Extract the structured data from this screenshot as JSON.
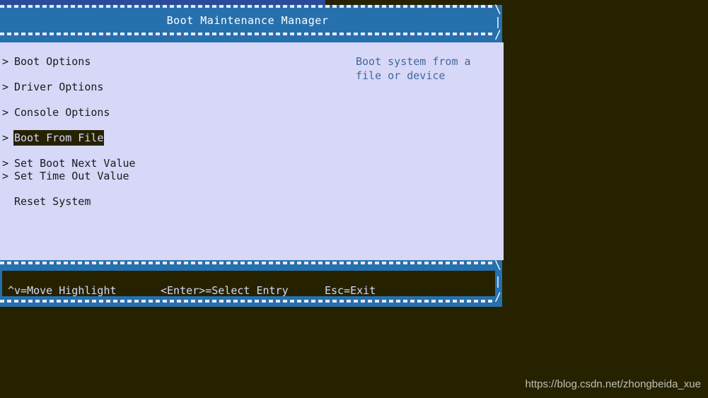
{
  "screen": {
    "background_color": "#262200",
    "accent_blue": "#2670AE",
    "panel_color": "#D7D8F8",
    "top_strip_color": "#2A4A9C"
  },
  "form": {
    "title": "Boot Maintenance Manager",
    "corner_glyphs": {
      "top_right": "\\",
      "middle_right": "|",
      "bottom_right": "/"
    }
  },
  "menu": {
    "items": [
      {
        "marker": ">",
        "label": "Boot Options",
        "selected": false
      },
      {
        "marker": ">",
        "label": "Driver Options",
        "selected": false
      },
      {
        "marker": ">",
        "label": "Console Options",
        "selected": false
      },
      {
        "marker": ">",
        "label": "Boot From File",
        "selected": true
      },
      {
        "marker": ">",
        "label": "Set Boot Next Value",
        "selected": false
      },
      {
        "marker": ">",
        "label": "Set Time Out Value",
        "selected": false
      },
      {
        "marker": "",
        "label": "Reset System",
        "selected": false
      }
    ]
  },
  "help": {
    "text": "Boot system from a\nfile or device",
    "color": "#41689A"
  },
  "footer": {
    "keys": [
      {
        "text": "^v=Move Highlight"
      },
      {
        "text": "<Enter>=Select Entry"
      },
      {
        "text": "Esc=Exit"
      }
    ],
    "corner_glyphs": {
      "top_right": "\\",
      "middle_right": "|",
      "bottom_right": "/"
    }
  },
  "watermark": {
    "text": "https://blog.csdn.net/zhongbeida_xue"
  }
}
